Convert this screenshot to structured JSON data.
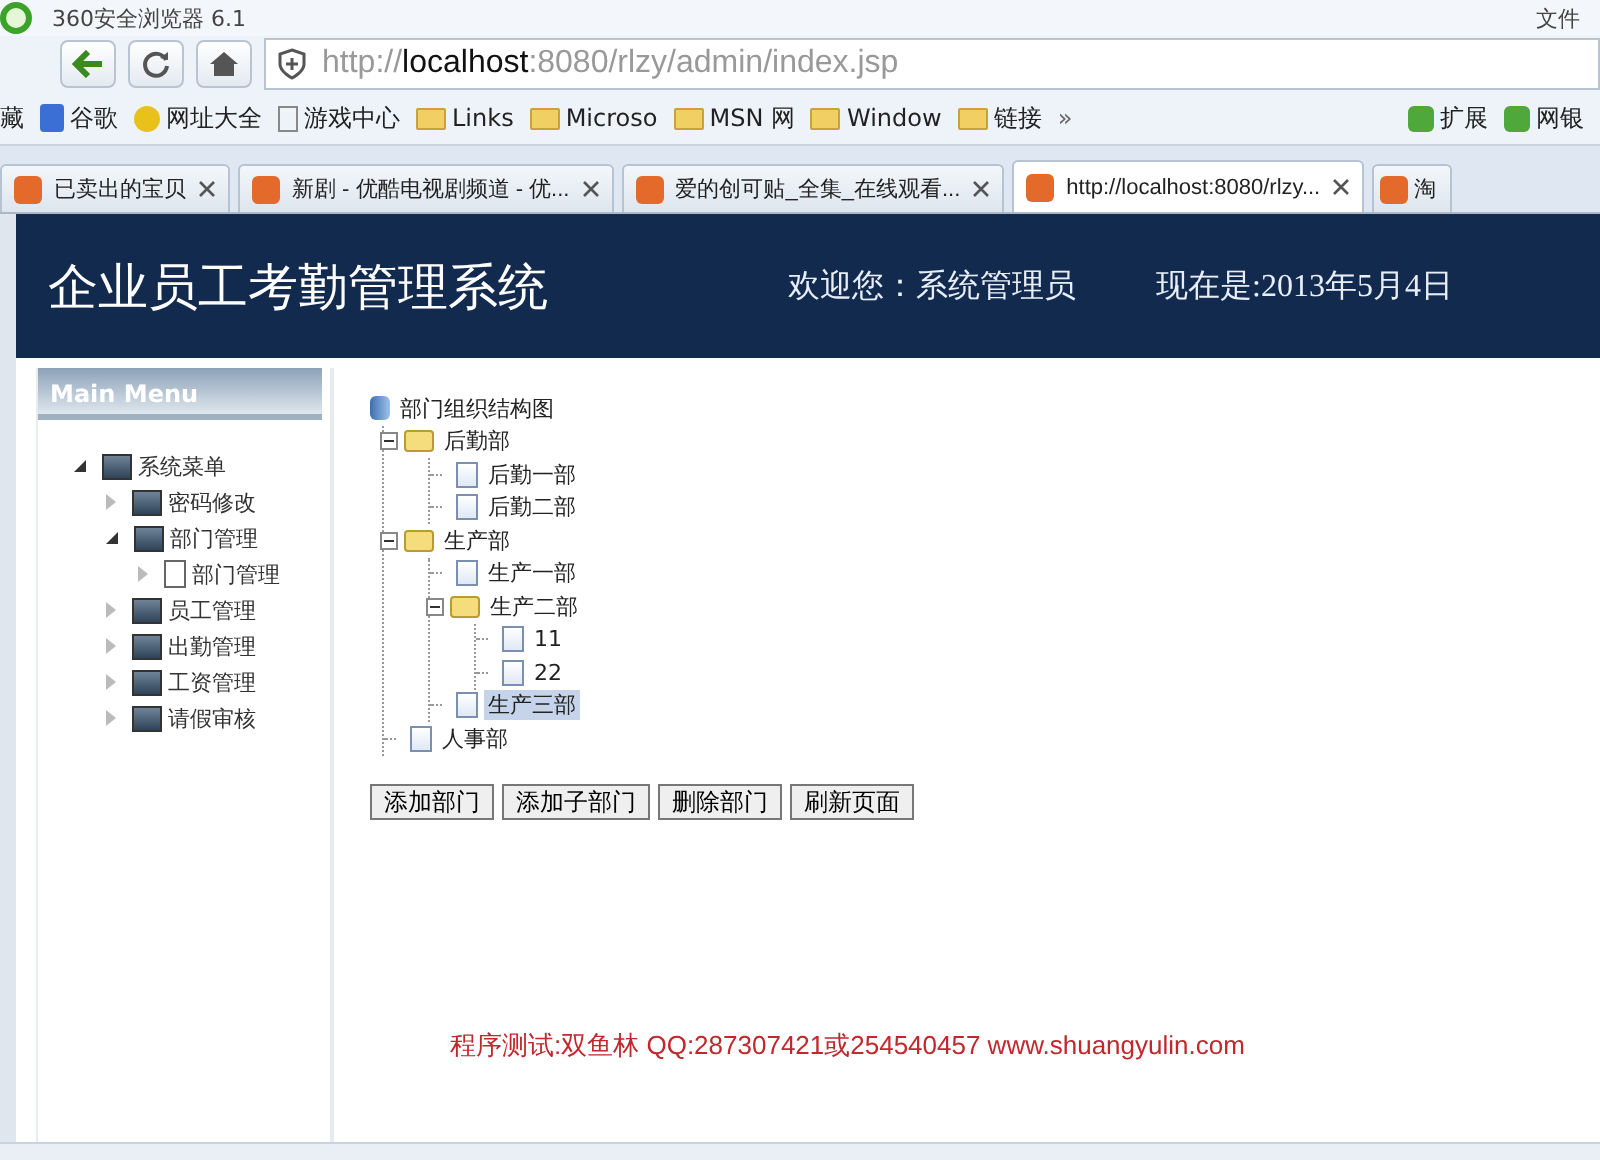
{
  "browser": {
    "title": "360安全浏览器 6.1",
    "menu": [
      "文件"
    ],
    "url": "http://**localhost**:8080/rlzy/admin/index.jsp",
    "bookmarks": [
      {
        "label": "藏",
        "kind": "dropdown"
      },
      {
        "label": "谷歌",
        "kind": "google"
      },
      {
        "label": "网址大全",
        "kind": "site"
      },
      {
        "label": "游戏中心",
        "kind": "page"
      },
      {
        "label": "Links",
        "kind": "folder"
      },
      {
        "label": "Microso",
        "kind": "folder"
      },
      {
        "label": "MSN 网",
        "kind": "folder"
      },
      {
        "label": "Window",
        "kind": "folder"
      },
      {
        "label": "链接",
        "kind": "folder"
      }
    ],
    "more": "»",
    "extras": [
      "扩展",
      "网银"
    ],
    "tabs": [
      {
        "label": "已卖出的宝贝",
        "selected": false
      },
      {
        "label": "新剧 - 优酷电视剧频道 - 优...",
        "selected": false
      },
      {
        "label": "爱的创可贴_全集_在线观看...",
        "selected": false
      },
      {
        "label": "http://localhost:8080/rlzy...",
        "selected": true
      },
      {
        "label": "淘",
        "selected": false
      }
    ]
  },
  "header": {
    "title": "企业员工考勤管理系统",
    "welcome": "欢迎您：系统管理员",
    "date": "现在是:2013年5月4日"
  },
  "sidebar": {
    "title": "Main Menu",
    "items": [
      {
        "label": "系统菜单",
        "kind": "folder",
        "expanded": true,
        "children": [
          {
            "label": "密码修改",
            "kind": "folder",
            "expanded": false
          },
          {
            "label": "部门管理",
            "kind": "folder",
            "expanded": true,
            "children": [
              {
                "label": "部门管理",
                "kind": "page",
                "expanded": false
              }
            ]
          },
          {
            "label": "员工管理",
            "kind": "folder",
            "expanded": false
          },
          {
            "label": "出勤管理",
            "kind": "folder",
            "expanded": false
          },
          {
            "label": "工资管理",
            "kind": "folder",
            "expanded": false
          },
          {
            "label": "请假审核",
            "kind": "folder",
            "expanded": false
          }
        ]
      }
    ]
  },
  "org_tree": {
    "root": "部门组织结构图",
    "nodes": [
      {
        "label": "后勤部",
        "kind": "folder",
        "expanded": true,
        "selected": false,
        "children": [
          {
            "label": "后勤一部",
            "kind": "leaf",
            "selected": false
          },
          {
            "label": "后勤二部",
            "kind": "leaf",
            "selected": false
          }
        ]
      },
      {
        "label": "生产部",
        "kind": "folder",
        "expanded": true,
        "selected": false,
        "children": [
          {
            "label": "生产一部",
            "kind": "leaf",
            "selected": false
          },
          {
            "label": "生产二部",
            "kind": "folder",
            "expanded": true,
            "selected": false,
            "children": [
              {
                "label": "11",
                "kind": "leaf",
                "selected": false
              },
              {
                "label": "22",
                "kind": "leaf",
                "selected": false
              }
            ]
          },
          {
            "label": "生产三部",
            "kind": "leaf",
            "selected": true
          }
        ]
      },
      {
        "label": "人事部",
        "kind": "leaf",
        "selected": false
      }
    ]
  },
  "buttons": [
    "添加部门",
    "添加子部门",
    "删除部门",
    "刷新页面"
  ],
  "footer": "程序测试:双鱼林 QQ:287307421或254540457 www.shuangyulin.com"
}
